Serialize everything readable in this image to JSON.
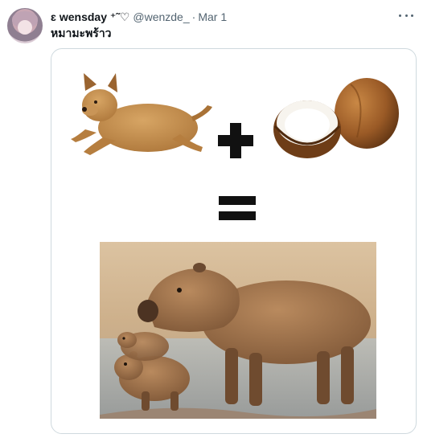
{
  "tweet": {
    "display_name": "ɛ wensday ⁺˜♡",
    "handle": "@wenzde_",
    "separator": "·",
    "date": "Mar 1",
    "text": "หมามะพร้าว"
  },
  "icons": {
    "more": "more-horizontal-icon",
    "avatar": "user-avatar"
  },
  "media": {
    "symbols": {
      "plus": "+",
      "equals": "="
    }
  },
  "colors": {
    "text": "#0f1419",
    "secondary_text": "#536471",
    "card_border": "#cfd9de"
  }
}
